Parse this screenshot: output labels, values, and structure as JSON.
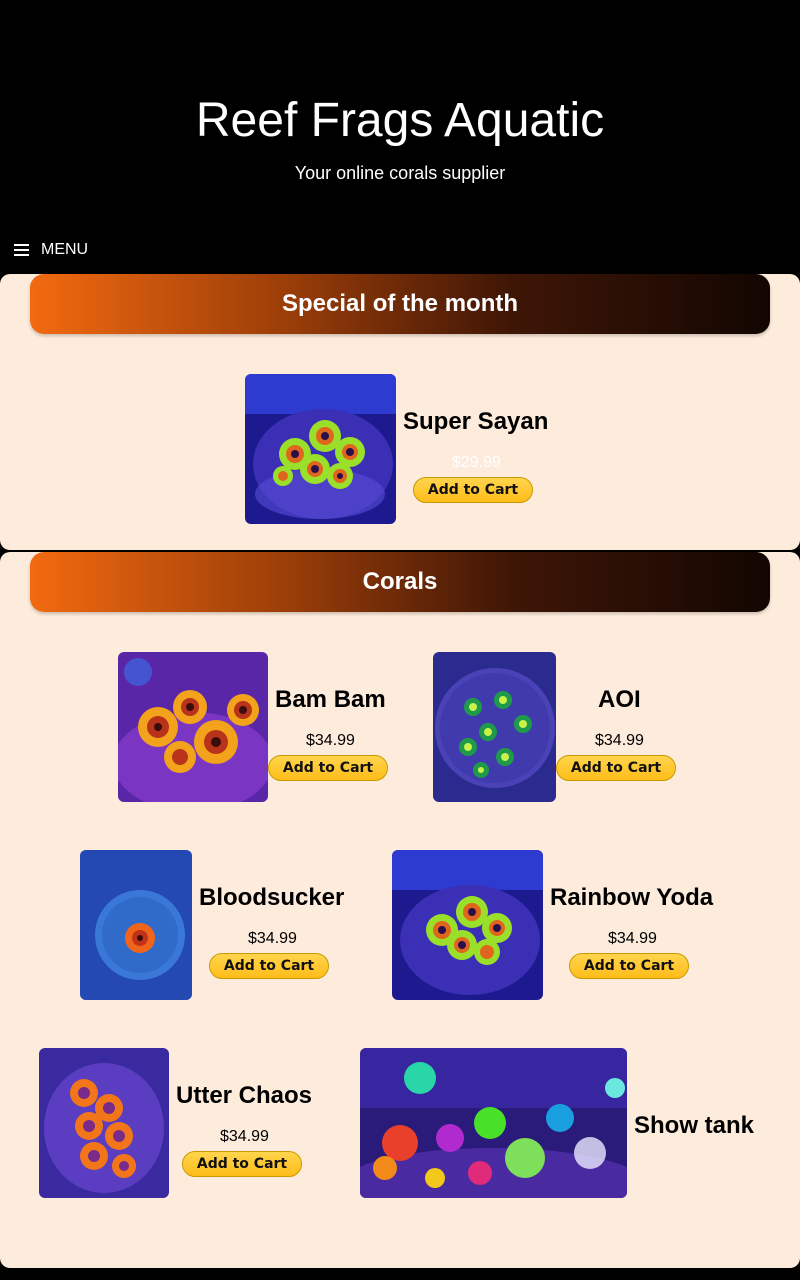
{
  "header": {
    "title": "Reef Frags Aquatic",
    "tagline": "Your online corals supplier",
    "menu_label": "MENU"
  },
  "special": {
    "heading": "Special of the month",
    "product": {
      "name": "Super Sayan",
      "price": "$29.99",
      "button": "Add to Cart"
    }
  },
  "corals": {
    "heading": "Corals",
    "products": [
      {
        "name": "Bam Bam",
        "price": "$34.99",
        "button": "Add to Cart"
      },
      {
        "name": "AOI",
        "price": "$34.99",
        "button": "Add to Cart"
      },
      {
        "name": "Bloodsucker",
        "price": "$34.99",
        "button": "Add to Cart"
      },
      {
        "name": "Rainbow Yoda",
        "price": "$34.99",
        "button": "Add to Cart"
      },
      {
        "name": "Utter Chaos",
        "price": "$34.99",
        "button": "Add to Cart"
      },
      {
        "name": "Show tank"
      }
    ]
  },
  "colors": {
    "header_bg": "#000000",
    "section_bg": "#fdebdb",
    "banner_start": "#f26a10",
    "banner_end": "#120602",
    "button_gold": "#ffc439"
  }
}
